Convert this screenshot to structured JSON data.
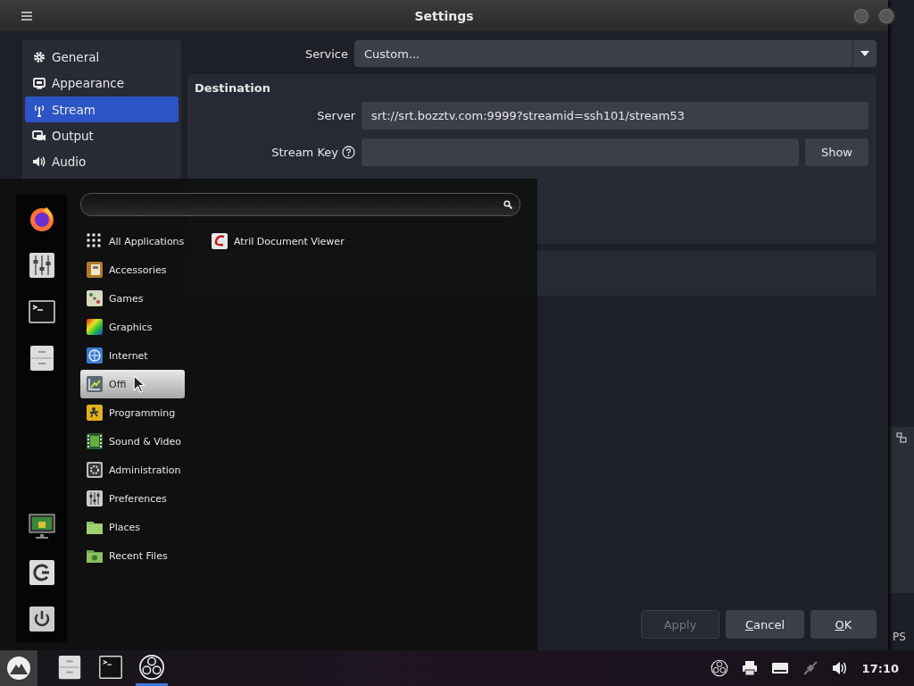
{
  "window": {
    "title": "Settings"
  },
  "sidebar": {
    "items": [
      {
        "label": "General",
        "selected": false
      },
      {
        "label": "Appearance",
        "selected": false
      },
      {
        "label": "Stream",
        "selected": true
      },
      {
        "label": "Output",
        "selected": false
      },
      {
        "label": "Audio",
        "selected": false
      }
    ]
  },
  "service": {
    "label": "Service",
    "value": "Custom..."
  },
  "destination": {
    "title": "Destination",
    "server": {
      "label": "Server",
      "value": "srt://srt.bozztv.com:9999?streamid=ssh101/stream53"
    },
    "stream_key": {
      "label": "Stream Key",
      "show_button": "Show"
    }
  },
  "buttons": [
    {
      "label": "Apply",
      "disabled": true
    },
    {
      "label": "Cancel",
      "disabled": false
    },
    {
      "label": "OK",
      "disabled": false
    }
  ],
  "background_window": {
    "text": "PS"
  },
  "menu": {
    "categories": [
      {
        "label": "All Applications",
        "selected": false
      },
      {
        "label": "Accessories",
        "selected": false
      },
      {
        "label": "Games",
        "selected": false
      },
      {
        "label": "Graphics",
        "selected": false
      },
      {
        "label": "Internet",
        "selected": false
      },
      {
        "label": "Offi",
        "selected": true
      },
      {
        "label": "Programming",
        "selected": false
      },
      {
        "label": "Sound & Video",
        "selected": false
      },
      {
        "label": "Administration",
        "selected": false
      },
      {
        "label": "Preferences",
        "selected": false
      },
      {
        "label": "Places",
        "selected": false
      },
      {
        "label": "Recent Files",
        "selected": false
      }
    ],
    "apps": [
      {
        "label": "Atril Document Viewer"
      }
    ]
  },
  "taskbar": {
    "apps": [
      {
        "selected": false
      },
      {
        "selected": false
      },
      {
        "selected": true
      }
    ],
    "clock": "17:10"
  }
}
